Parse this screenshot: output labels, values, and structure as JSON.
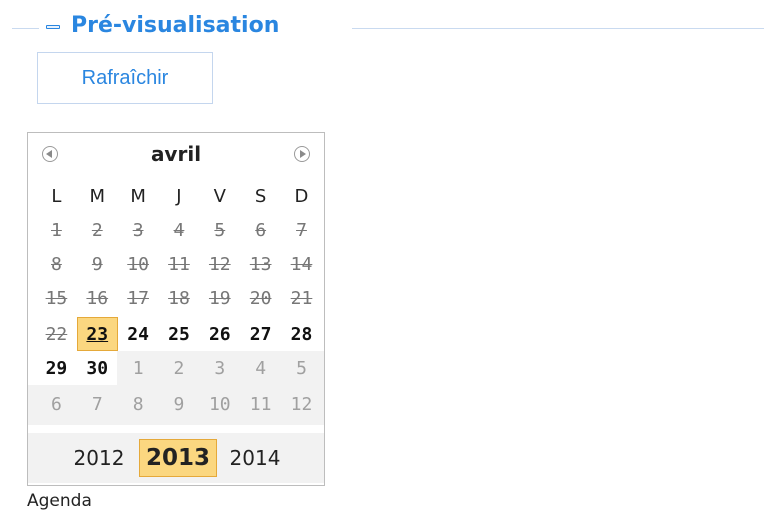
{
  "section": {
    "legend_title": "Pré-visualisation",
    "collapse_icon": "minus-collapse-icon"
  },
  "toolbar": {
    "refresh_label": "Rafraîchir"
  },
  "calendar": {
    "month": "avril",
    "prev_icon": "circle-arrow-left-icon",
    "next_icon": "circle-arrow-right-icon",
    "weekdays": [
      "L",
      "M",
      "M",
      "J",
      "V",
      "S",
      "D"
    ],
    "weeks": [
      [
        {
          "d": "1",
          "s": "past"
        },
        {
          "d": "2",
          "s": "past"
        },
        {
          "d": "3",
          "s": "past"
        },
        {
          "d": "4",
          "s": "past"
        },
        {
          "d": "5",
          "s": "past"
        },
        {
          "d": "6",
          "s": "past"
        },
        {
          "d": "7",
          "s": "past"
        }
      ],
      [
        {
          "d": "8",
          "s": "past"
        },
        {
          "d": "9",
          "s": "past"
        },
        {
          "d": "10",
          "s": "past"
        },
        {
          "d": "11",
          "s": "past"
        },
        {
          "d": "12",
          "s": "past"
        },
        {
          "d": "13",
          "s": "past"
        },
        {
          "d": "14",
          "s": "past"
        }
      ],
      [
        {
          "d": "15",
          "s": "past"
        },
        {
          "d": "16",
          "s": "past"
        },
        {
          "d": "17",
          "s": "past"
        },
        {
          "d": "18",
          "s": "past"
        },
        {
          "d": "19",
          "s": "past"
        },
        {
          "d": "20",
          "s": "past"
        },
        {
          "d": "21",
          "s": "past"
        }
      ],
      [
        {
          "d": "22",
          "s": "past"
        },
        {
          "d": "23",
          "s": "today"
        },
        {
          "d": "24",
          "s": "current"
        },
        {
          "d": "25",
          "s": "current"
        },
        {
          "d": "26",
          "s": "current"
        },
        {
          "d": "27",
          "s": "current"
        },
        {
          "d": "28",
          "s": "current"
        }
      ],
      [
        {
          "d": "29",
          "s": "current"
        },
        {
          "d": "30",
          "s": "current"
        },
        {
          "d": "1",
          "s": "other"
        },
        {
          "d": "2",
          "s": "other"
        },
        {
          "d": "3",
          "s": "other"
        },
        {
          "d": "4",
          "s": "other"
        },
        {
          "d": "5",
          "s": "other"
        }
      ],
      [
        {
          "d": "6",
          "s": "other"
        },
        {
          "d": "7",
          "s": "other"
        },
        {
          "d": "8",
          "s": "other"
        },
        {
          "d": "9",
          "s": "other"
        },
        {
          "d": "10",
          "s": "other"
        },
        {
          "d": "11",
          "s": "other"
        },
        {
          "d": "12",
          "s": "other"
        }
      ]
    ],
    "years": [
      "2012",
      "2013",
      "2014"
    ],
    "selected_year": "2013"
  },
  "footer": {
    "label": "Agenda"
  },
  "colors": {
    "accent": "#2a86e0",
    "highlight": "#fbd780",
    "highlight_border": "#e5a93a"
  }
}
